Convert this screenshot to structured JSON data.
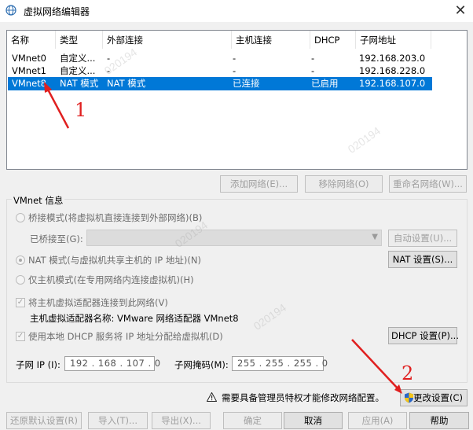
{
  "window": {
    "title": "虚拟网络编辑器",
    "close_label": "✕"
  },
  "list": {
    "columns": [
      "名称",
      "类型",
      "外部连接",
      "主机连接",
      "DHCP",
      "子网地址"
    ],
    "rows": [
      {
        "name": "VMnet0",
        "type": "自定义...",
        "external": "-",
        "host": "-",
        "dhcp": "-",
        "subnet": "192.168.203.0",
        "selected": false
      },
      {
        "name": "VMnet1",
        "type": "自定义...",
        "external": "-",
        "host": "-",
        "dhcp": "-",
        "subnet": "192.168.228.0",
        "selected": false
      },
      {
        "name": "VMnet8",
        "type": "NAT 模式",
        "external": "NAT 模式",
        "host": "已连接",
        "dhcp": "已启用",
        "subnet": "192.168.107.0",
        "selected": true
      }
    ]
  },
  "list_buttons": {
    "add": "添加网络(E)...",
    "remove": "移除网络(O)",
    "rename": "重命名网络(W)..."
  },
  "vmnet_info": {
    "title": "VMnet 信息",
    "bridge_mode": "桥接模式(将虚拟机直接连接到外部网络)(B)",
    "bridged_to_label": "已桥接至(G):",
    "auto_settings": "自动设置(U)...",
    "nat_mode": "NAT 模式(与虚拟机共享主机的 IP 地址)(N)",
    "nat_settings": "NAT 设置(S)...",
    "host_only_mode": "仅主机模式(在专用网络内连接虚拟机)(H)",
    "connect_adapter": "将主机虚拟适配器连接到此网络(V)",
    "adapter_name": "主机虚拟适配器名称: VMware 网络适配器 VMnet8",
    "use_dhcp": "使用本地 DHCP 服务将 IP 地址分配给虚拟机(D)",
    "dhcp_settings": "DHCP 设置(P)...",
    "subnet_ip_label": "子网 IP (I):",
    "subnet_ip": "192 . 168 . 107 .  0",
    "subnet_mask_label": "子网掩码(M):",
    "subnet_mask": "255 . 255 . 255 .  0"
  },
  "admin": {
    "warning": "需要具备管理员特权才能修改网络配置。",
    "change_settings": "更改设置(C)"
  },
  "footer": {
    "restore": "还原默认设置(R)",
    "import": "导入(T)...",
    "export": "导出(X)...",
    "ok": "确定",
    "cancel": "取消",
    "apply": "应用(A)",
    "help": "帮助"
  },
  "annotations": {
    "one": "1",
    "two": "2"
  },
  "watermark": "020194"
}
